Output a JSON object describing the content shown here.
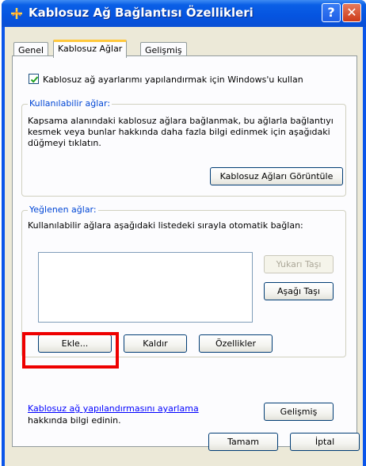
{
  "window": {
    "title": "Kablosuz Ağ Bağlantısı Özellikleri",
    "help_glyph": "?",
    "close_glyph": "✕"
  },
  "tabs": [
    {
      "label": "Genel",
      "active": false
    },
    {
      "label": "Kablosuz Ağlar",
      "active": true
    },
    {
      "label": "Gelişmiş",
      "active": false
    }
  ],
  "main": {
    "use_windows_checkbox": {
      "label": "Kablosuz ağ ayarlarımı yapılandırmak için Windows'u kullan",
      "checked": true
    },
    "available_networks": {
      "legend": "Kullanılabilir ağlar:",
      "description": "Kapsama alanındaki kablosuz ağlara bağlanmak, bu ağlarla bağlantıyı kesmek veya bunlar hakkında daha fazla bilgi edinmek için aşağıdaki düğmeyi tıklatın.",
      "view_button": "Kablosuz Ağları Görüntüle"
    },
    "preferred_networks": {
      "legend": "Yeğlenen ağlar:",
      "description": "Kullanılabilir ağlara aşağıdaki listedeki sırayla otomatik bağlan:",
      "list_items": [],
      "move_up_button": "Yukarı Taşı",
      "move_down_button": "Aşağı Taşı",
      "add_button": "Ekle...",
      "remove_button": "Kaldır",
      "properties_button": "Özellikler"
    },
    "learn_link": "Kablosuz ağ yapılandırmasını ayarlama",
    "learn_suffix": "hakkında bilgi edinin.",
    "advanced_button": "Gelişmiş"
  },
  "footer": {
    "ok_button": "Tamam",
    "cancel_button": "İptal"
  },
  "colors": {
    "titlebar": "#0a55ea",
    "highlight": "#ee0000",
    "group_legend": "#0046d5",
    "link": "#0000ff"
  }
}
